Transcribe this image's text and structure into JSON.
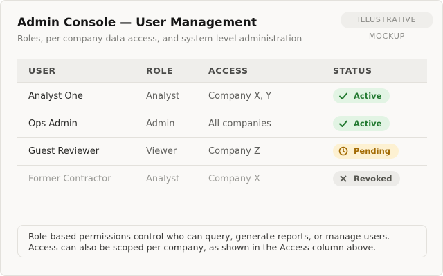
{
  "badge": "ILLUSTRATIVE MOCKUP",
  "header": {
    "title": "Admin Console — User Management",
    "subtitle": "Roles, per-company data access, and system-level administration"
  },
  "table": {
    "columns": [
      "USER",
      "ROLE",
      "ACCESS",
      "STATUS"
    ],
    "rows": [
      {
        "user": "Analyst One",
        "role": "Analyst",
        "access": "Company X, Y",
        "status": "Active",
        "status_icon": "check-icon"
      },
      {
        "user": "Ops Admin",
        "role": "Admin",
        "access": "All companies",
        "status": "Active",
        "status_icon": "check-icon"
      },
      {
        "user": "Guest Reviewer",
        "role": "Viewer",
        "access": "Company Z",
        "status": "Pending",
        "status_icon": "clock-icon"
      },
      {
        "user": "Former Contractor",
        "role": "Analyst",
        "access": "Company X",
        "status": "Revoked",
        "status_icon": "x-icon"
      }
    ]
  },
  "note": {
    "line1": "Role-based permissions control who can query, generate reports, or manage users.",
    "line2": "Access can also be scoped per company, as shown in the Access column above."
  },
  "colors": {
    "active": "#237a31",
    "pending": "#a36b05",
    "revoked": "#55554f"
  }
}
